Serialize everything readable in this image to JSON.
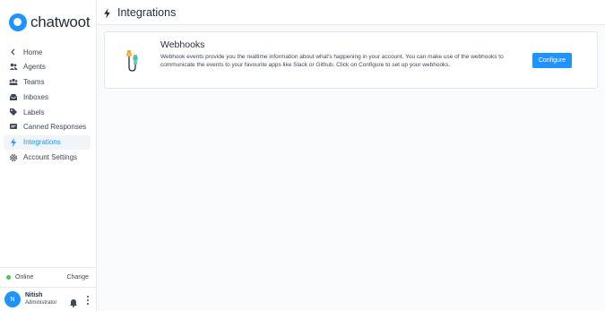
{
  "brand": {
    "name": "chatwoot",
    "accent": "#1f93ff"
  },
  "sidebar": {
    "items": [
      {
        "label": "Home",
        "icon": "chevron-left-icon",
        "active": false
      },
      {
        "label": "Agents",
        "icon": "people-icon",
        "active": false
      },
      {
        "label": "Teams",
        "icon": "team-icon",
        "active": false
      },
      {
        "label": "Inboxes",
        "icon": "inbox-icon",
        "active": false
      },
      {
        "label": "Labels",
        "icon": "tag-icon",
        "active": false
      },
      {
        "label": "Canned Responses",
        "icon": "chat-bubble-icon",
        "active": false
      },
      {
        "label": "Integrations",
        "icon": "lightning-icon",
        "active": true
      },
      {
        "label": "Account Settings",
        "icon": "gear-icon",
        "active": false
      }
    ]
  },
  "status": {
    "label": "Online",
    "change_label": "Change",
    "dot_color": "#44ce4b"
  },
  "user": {
    "initial": "N",
    "name": "Nitish",
    "role": "Administrator"
  },
  "header": {
    "title": "Integrations",
    "icon": "lightning-icon"
  },
  "webhooks": {
    "title": "Webhooks",
    "description": "Webhook events provide you the realtime information about what's happening in your account. You can make use of the webhooks to communicate the events to your favourite apps like Slack or Github. Click on Configure to set up your webhooks.",
    "button_label": "Configure",
    "icon": "webhook-cable-icon"
  }
}
